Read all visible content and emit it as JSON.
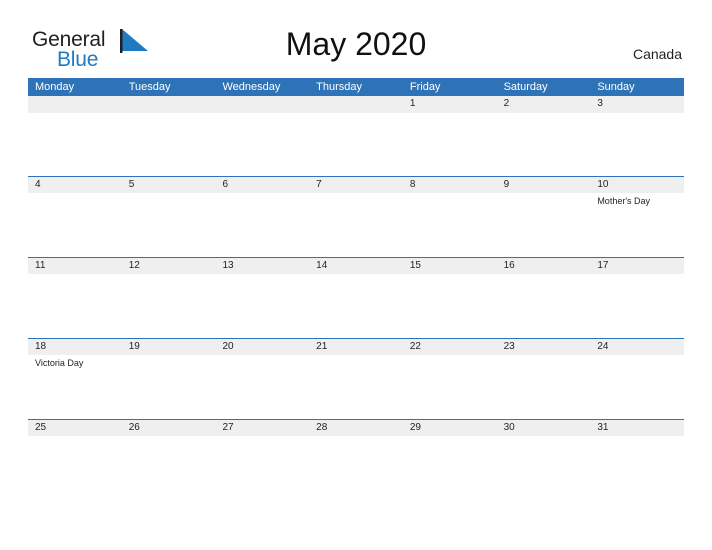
{
  "brand": {
    "name_part1": "General",
    "name_part2": "Blue",
    "flag_icon": "blue-flag-triangle"
  },
  "header": {
    "title": "May 2020",
    "region": "Canada"
  },
  "colors": {
    "header_blue": "#2e73b8",
    "band_gray": "#efefef",
    "brand_blue": "#1f7ac4",
    "text_dark": "#231f20"
  },
  "calendar": {
    "month": "May",
    "year": "2020",
    "weekdays": [
      "Monday",
      "Tuesday",
      "Wednesday",
      "Thursday",
      "Friday",
      "Saturday",
      "Sunday"
    ],
    "weeks": [
      [
        {
          "num": "",
          "event": ""
        },
        {
          "num": "",
          "event": ""
        },
        {
          "num": "",
          "event": ""
        },
        {
          "num": "",
          "event": ""
        },
        {
          "num": "1",
          "event": ""
        },
        {
          "num": "2",
          "event": ""
        },
        {
          "num": "3",
          "event": ""
        }
      ],
      [
        {
          "num": "4",
          "event": ""
        },
        {
          "num": "5",
          "event": ""
        },
        {
          "num": "6",
          "event": ""
        },
        {
          "num": "7",
          "event": ""
        },
        {
          "num": "8",
          "event": ""
        },
        {
          "num": "9",
          "event": ""
        },
        {
          "num": "10",
          "event": "Mother's Day"
        }
      ],
      [
        {
          "num": "11",
          "event": ""
        },
        {
          "num": "12",
          "event": ""
        },
        {
          "num": "13",
          "event": ""
        },
        {
          "num": "14",
          "event": ""
        },
        {
          "num": "15",
          "event": ""
        },
        {
          "num": "16",
          "event": ""
        },
        {
          "num": "17",
          "event": ""
        }
      ],
      [
        {
          "num": "18",
          "event": "Victoria Day"
        },
        {
          "num": "19",
          "event": ""
        },
        {
          "num": "20",
          "event": ""
        },
        {
          "num": "21",
          "event": ""
        },
        {
          "num": "22",
          "event": ""
        },
        {
          "num": "23",
          "event": ""
        },
        {
          "num": "24",
          "event": ""
        }
      ],
      [
        {
          "num": "25",
          "event": ""
        },
        {
          "num": "26",
          "event": ""
        },
        {
          "num": "27",
          "event": ""
        },
        {
          "num": "28",
          "event": ""
        },
        {
          "num": "29",
          "event": ""
        },
        {
          "num": "30",
          "event": ""
        },
        {
          "num": "31",
          "event": ""
        }
      ]
    ]
  }
}
